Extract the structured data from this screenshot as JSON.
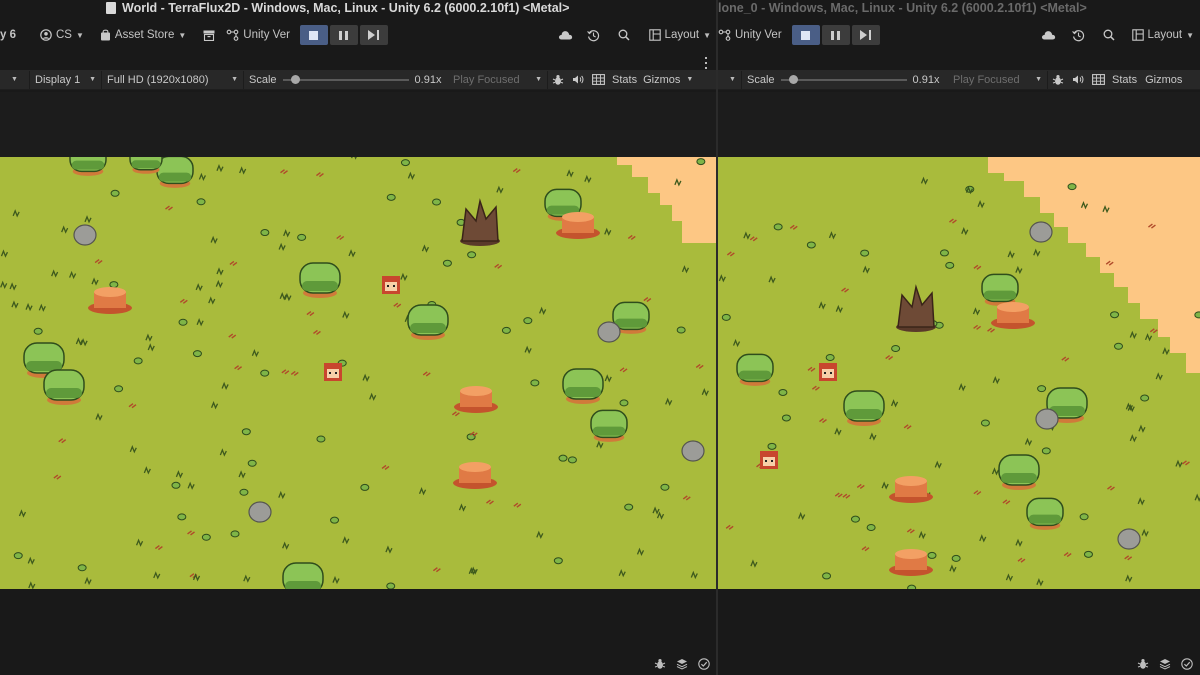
{
  "left": {
    "title": "World - TerraFlux2D - Windows, Mac, Linux - Unity 6.2 (6000.2.10f1) <Metal>",
    "toolbar": {
      "version_fragment": "y 6",
      "account": "CS",
      "asset_store": "Asset Store",
      "version_control": "Unity Ver",
      "layout": "Layout"
    },
    "gamebar": {
      "display": "Display 1",
      "resolution": "Full HD (1920x1080)",
      "scale_label": "Scale",
      "scale_value": "0.91x",
      "scale_fraction": 0.1,
      "play_mode": "Play Focused",
      "stats": "Stats",
      "gizmos": "Gizmos"
    }
  },
  "right": {
    "title": "lone_0 - Windows, Mac, Linux - Unity 6.2 (6000.2.10f1) <Metal>",
    "toolbar": {
      "version_control": "Unity Ver",
      "layout": "Layout"
    },
    "gamebar": {
      "scale_label": "Scale",
      "scale_value": "0.91x",
      "scale_fraction": 0.1,
      "play_mode": "Play Focused",
      "stats": "Stats",
      "gizmos": "Gizmos"
    }
  },
  "icons": {
    "toolbar": [
      "account-icon",
      "shopping-bag-icon",
      "package-icon",
      "version-control-icon",
      "stop-icon",
      "pause-icon",
      "step-icon",
      "cloud-icon",
      "history-icon",
      "search-icon",
      "layout-icon"
    ],
    "gamebar": [
      "bug-icon",
      "audio-icon",
      "grid-icon",
      "more-icon"
    ],
    "statusbar": [
      "bug-icon",
      "stack-icon",
      "check-circle-icon"
    ]
  },
  "colors": {
    "grass": "#a9bb3c",
    "sand": "#fdc784",
    "play_active": "#4a5e86",
    "editor_bg": "#191919"
  }
}
